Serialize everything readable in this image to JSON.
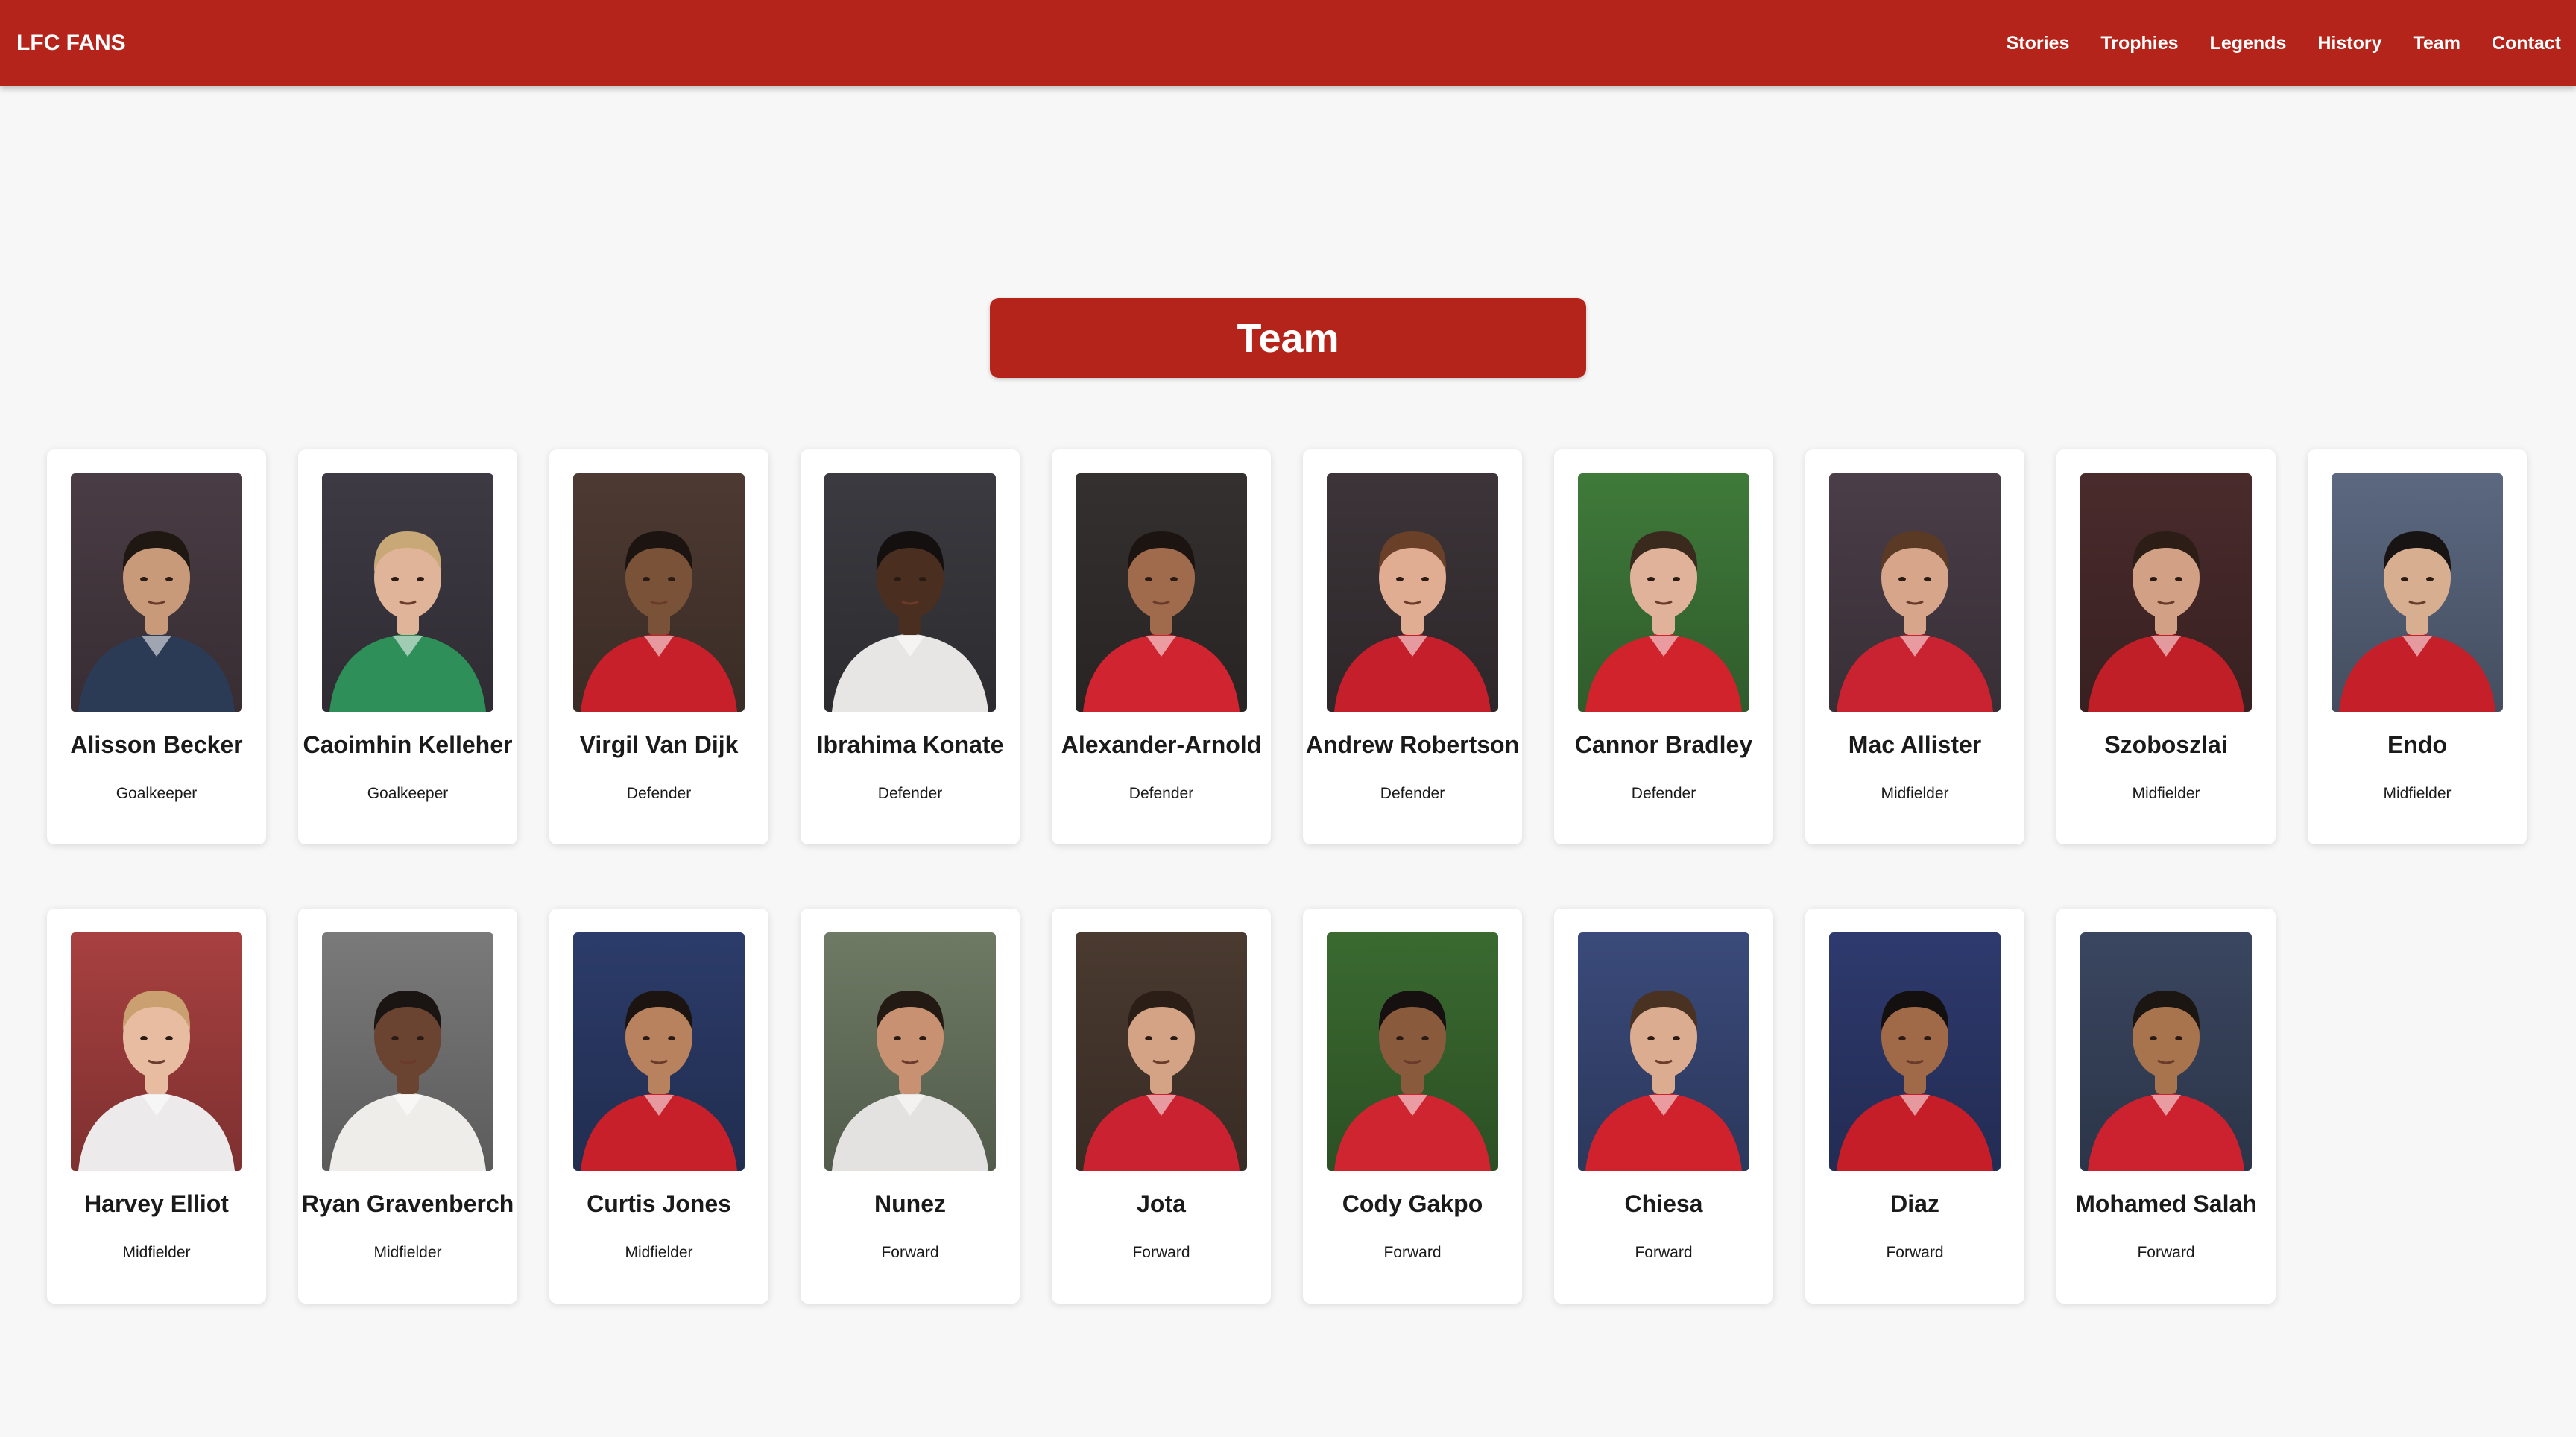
{
  "brand": "LFC FANS",
  "nav": [
    "Stories",
    "Trophies",
    "Legends",
    "History",
    "Team",
    "Contact"
  ],
  "section_title": "Team",
  "players": [
    {
      "name": "Alisson Becker",
      "position": "Goalkeeper",
      "bg": "#4a3c44",
      "kit": "#2c3b55",
      "skin": "#c99a7a",
      "hair": "#1f1812"
    },
    {
      "name": "Caoimhin Kelleher",
      "position": "Goalkeeper",
      "bg": "#3e3a44",
      "kit": "#2e8f58",
      "skin": "#e0b498",
      "hair": "#c9a878"
    },
    {
      "name": "Virgil Van Dijk",
      "position": "Defender",
      "bg": "#4d3a32",
      "kit": "#c8202a",
      "skin": "#7a5238",
      "hair": "#1c1410"
    },
    {
      "name": "Ibrahima Konate",
      "position": "Defender",
      "bg": "#3a3a40",
      "kit": "#e8e6e4",
      "skin": "#4a2e20",
      "hair": "#151010"
    },
    {
      "name": "Alexander-Arnold",
      "position": "Defender",
      "bg": "#34302f",
      "kit": "#d02430",
      "skin": "#a06a4c",
      "hair": "#1b1410"
    },
    {
      "name": "Andrew Robertson",
      "position": "Defender",
      "bg": "#3c3438",
      "kit": "#c51f2c",
      "skin": "#e0ac92",
      "hair": "#6a4028"
    },
    {
      "name": "Cannor Bradley",
      "position": "Defender",
      "bg": "#3f7a3a",
      "kit": "#d0232c",
      "skin": "#e0b29a",
      "hair": "#3a2a1e"
    },
    {
      "name": "Mac Allister",
      "position": "Midfielder",
      "bg": "#4a3e48",
      "kit": "#c92230",
      "skin": "#d6a58a",
      "hair": "#5a3a24"
    },
    {
      "name": "Szoboszlai",
      "position": "Midfielder",
      "bg": "#4a2b2c",
      "kit": "#c01f28",
      "skin": "#d2a084",
      "hair": "#2c1e16"
    },
    {
      "name": "Endo",
      "position": "Midfielder",
      "bg": "#5b6880",
      "kit": "#c51f2a",
      "skin": "#d8ae90",
      "hair": "#181414"
    },
    {
      "name": "Harvey Elliot",
      "position": "Midfielder",
      "bg": "#a84040",
      "kit": "#eceaea",
      "skin": "#e8bca0",
      "hair": "#caa070"
    },
    {
      "name": "Ryan Gravenberch",
      "position": "Midfielder",
      "bg": "#7a7a7a",
      "kit": "#efedea",
      "skin": "#6a4430",
      "hair": "#1a1412"
    },
    {
      "name": "Curtis Jones",
      "position": "Midfielder",
      "bg": "#2c3c6a",
      "kit": "#c8202a",
      "skin": "#b8825e",
      "hair": "#1c1410"
    },
    {
      "name": "Nunez",
      "position": "Forward",
      "bg": "#6e7a64",
      "kit": "#e4e2e0",
      "skin": "#c89272",
      "hair": "#241a14"
    },
    {
      "name": "Jota",
      "position": "Forward",
      "bg": "#4a3a30",
      "kit": "#ca2230",
      "skin": "#d4a284",
      "hair": "#2a1e16"
    },
    {
      "name": "Cody Gakpo",
      "position": "Forward",
      "bg": "#3a6a30",
      "kit": "#cf2530",
      "skin": "#8a5a3c",
      "hair": "#161010"
    },
    {
      "name": "Chiesa",
      "position": "Forward",
      "bg": "#3a4a7a",
      "kit": "#d0222c",
      "skin": "#dcac90",
      "hair": "#4a3222"
    },
    {
      "name": "Diaz",
      "position": "Forward",
      "bg": "#2e3a6e",
      "kit": "#c51e28",
      "skin": "#a06a48",
      "hair": "#141010"
    },
    {
      "name": "Mohamed Salah",
      "position": "Forward",
      "bg": "#3a4660",
      "kit": "#cc2230",
      "skin": "#a8744e",
      "hair": "#1c1612"
    }
  ]
}
